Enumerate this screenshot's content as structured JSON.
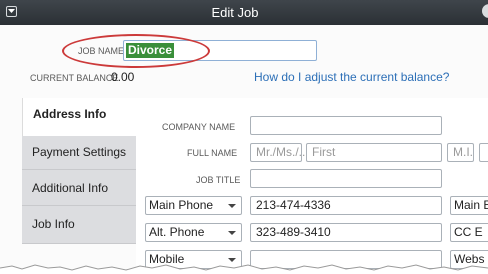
{
  "window": {
    "title": "Edit Job"
  },
  "job_name": {
    "label": "JOB NAME",
    "value": "Divorce"
  },
  "balance": {
    "label": "CURRENT BALANCE",
    "value": "0.00",
    "adjust_link": "How do I adjust the current balance?"
  },
  "tabs": [
    {
      "label": "Address Info",
      "active": true
    },
    {
      "label": "Payment Settings",
      "active": false
    },
    {
      "label": "Additional Info",
      "active": false
    },
    {
      "label": "Job Info",
      "active": false
    }
  ],
  "form": {
    "company_name_label": "COMPANY NAME",
    "company_name_value": "",
    "full_name_label": "FULL NAME",
    "salutation_placeholder": "Mr./Ms./...",
    "first_placeholder": "First",
    "mi_placeholder": "M.I.",
    "job_title_label": "JOB TITLE",
    "job_title_value": ""
  },
  "phones": [
    {
      "type": "Main Phone",
      "value": "213-474-4336",
      "right_label": "Main E"
    },
    {
      "type": "Alt. Phone",
      "value": "323-489-3410",
      "right_label": "CC E"
    },
    {
      "type": "Mobile",
      "value": "",
      "right_label": "Webs"
    }
  ],
  "colors": {
    "titlebar": "#2f3439",
    "selection": "#3a8f3a",
    "highlight_oval": "#cc3a3a",
    "link": "#2c6fb7"
  },
  "icons": {
    "window_menu": "chevron-down-icon",
    "dropdown": "caret-down-icon"
  }
}
